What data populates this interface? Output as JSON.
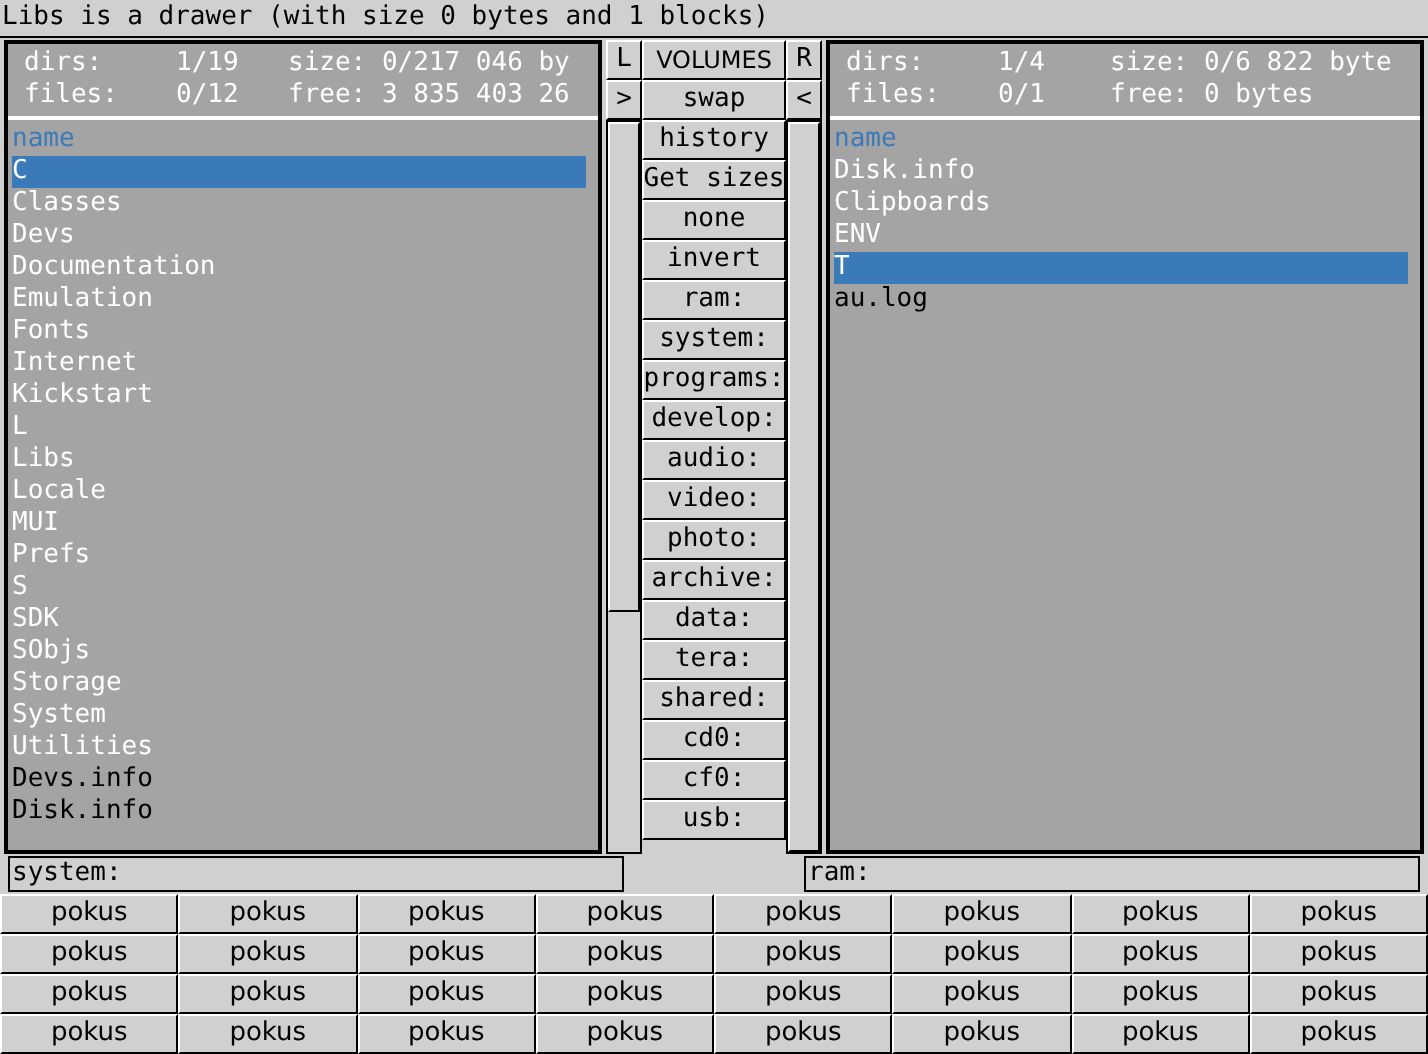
{
  "status_title": "Libs is a drawer (with size 0 bytes and 1 blocks)",
  "left_panel": {
    "stats": [
      [
        "dirs:",
        "1/19",
        "size: 0/217 046 by"
      ],
      [
        "files:",
        "0/12",
        "free: 3 835 403 26"
      ]
    ],
    "header": "name",
    "path": "system:",
    "entries": [
      {
        "name": "C",
        "kind": "dir",
        "selected": true
      },
      {
        "name": "Classes",
        "kind": "dir",
        "selected": false
      },
      {
        "name": "Devs",
        "kind": "dir",
        "selected": false
      },
      {
        "name": "Documentation",
        "kind": "dir",
        "selected": false
      },
      {
        "name": "Emulation",
        "kind": "dir",
        "selected": false
      },
      {
        "name": "Fonts",
        "kind": "dir",
        "selected": false
      },
      {
        "name": "Internet",
        "kind": "dir",
        "selected": false
      },
      {
        "name": "Kickstart",
        "kind": "dir",
        "selected": false
      },
      {
        "name": "L",
        "kind": "dir",
        "selected": false
      },
      {
        "name": "Libs",
        "kind": "dir",
        "selected": false
      },
      {
        "name": "Locale",
        "kind": "dir",
        "selected": false
      },
      {
        "name": "MUI",
        "kind": "dir",
        "selected": false
      },
      {
        "name": "Prefs",
        "kind": "dir",
        "selected": false
      },
      {
        "name": "S",
        "kind": "dir",
        "selected": false
      },
      {
        "name": "SDK",
        "kind": "dir",
        "selected": false
      },
      {
        "name": "SObjs",
        "kind": "dir",
        "selected": false
      },
      {
        "name": "Storage",
        "kind": "dir",
        "selected": false
      },
      {
        "name": "System",
        "kind": "dir",
        "selected": false
      },
      {
        "name": "Utilities",
        "kind": "dir",
        "selected": false
      },
      {
        "name": "Devs.info",
        "kind": "file",
        "selected": false
      },
      {
        "name": "Disk.info",
        "kind": "file",
        "selected": false
      }
    ]
  },
  "right_panel": {
    "stats": [
      [
        "dirs:",
        "1/4",
        "size: 0/6 822 byte"
      ],
      [
        "files:",
        "0/1",
        "free: 0 bytes"
      ]
    ],
    "header": "name",
    "path": "ram:",
    "entries": [
      {
        "name": "Disk.info",
        "kind": "dir",
        "selected": false
      },
      {
        "name": "Clipboards",
        "kind": "dir",
        "selected": false
      },
      {
        "name": "ENV",
        "kind": "dir",
        "selected": false
      },
      {
        "name": "T",
        "kind": "dir",
        "selected": true
      },
      {
        "name": "au.log",
        "kind": "file",
        "selected": false
      }
    ]
  },
  "middle": {
    "top_row": [
      "L",
      "VOLUMES",
      "R"
    ],
    "second_row": [
      ">",
      "swap",
      "<"
    ],
    "buttons": [
      "history",
      "Get sizes",
      "none",
      "invert",
      "ram:",
      "system:",
      "programs:",
      "develop:",
      "audio:",
      "video:",
      "photo:",
      "archive:",
      "data:",
      "tera:",
      "shared:",
      "cd0:",
      "cf0:",
      "usb:"
    ]
  },
  "button_grid": [
    [
      "pokus",
      "pokus",
      "pokus",
      "pokus",
      "pokus",
      "pokus",
      "pokus",
      "pokus"
    ],
    [
      "pokus",
      "pokus",
      "pokus",
      "pokus",
      "pokus",
      "pokus",
      "pokus",
      "pokus"
    ],
    [
      "pokus",
      "pokus",
      "pokus",
      "pokus",
      "pokus",
      "pokus",
      "pokus",
      "pokus"
    ],
    [
      "pokus",
      "pokus",
      "pokus",
      "pokus",
      "pokus",
      "pokus",
      "pokus",
      "pokus"
    ]
  ]
}
